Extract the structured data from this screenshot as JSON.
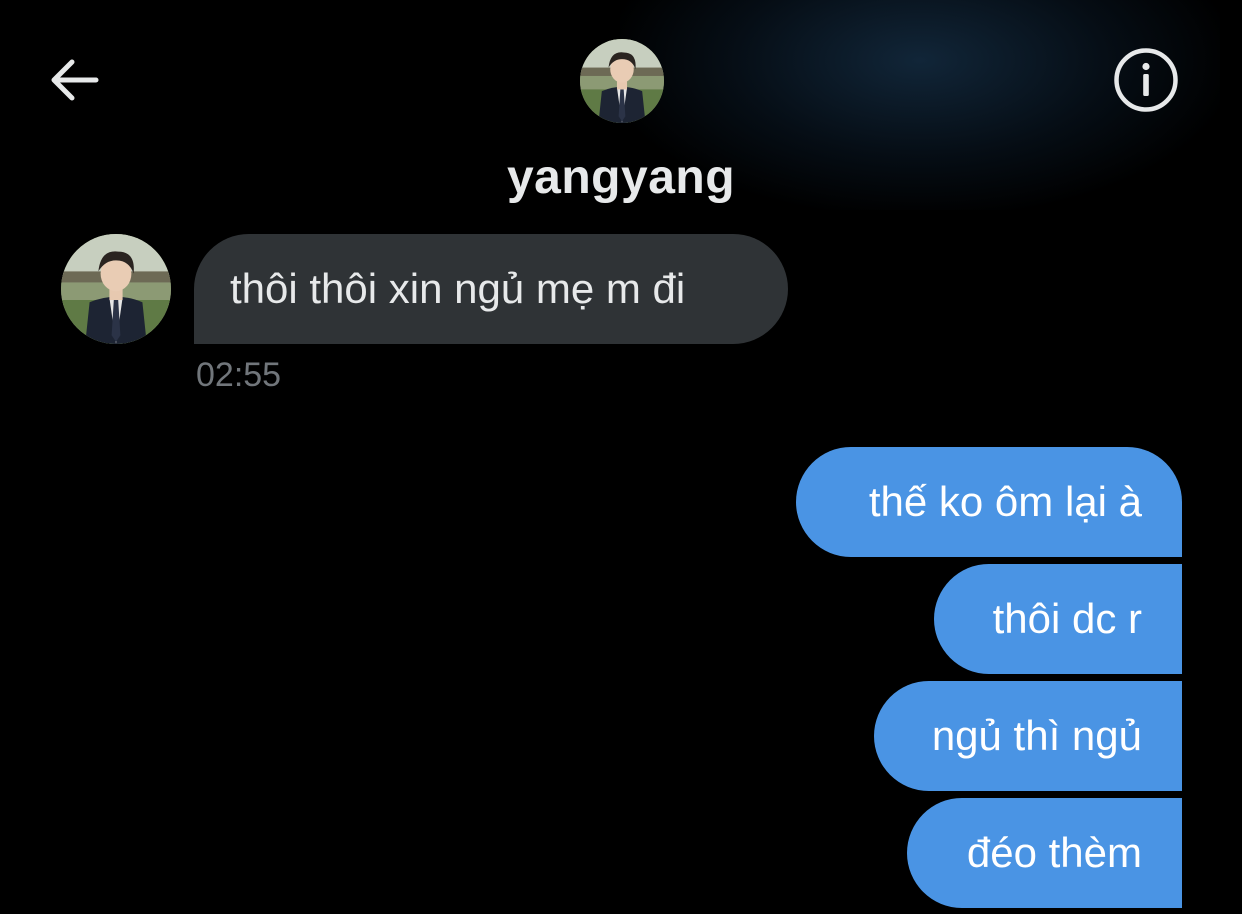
{
  "header": {
    "name": "yangyang",
    "back_icon": "arrow-left-icon",
    "info_icon": "info-circle-icon"
  },
  "conversation": {
    "incoming": [
      {
        "text": "thôi thôi xin ngủ mẹ m đi",
        "time": "02:55"
      }
    ],
    "outgoing": [
      {
        "text": "thế ko ôm lại à"
      },
      {
        "text": "thôi dc r"
      },
      {
        "text": "ngủ thì ngủ"
      },
      {
        "text": "đéo thèm"
      }
    ]
  },
  "colors": {
    "background": "#000000",
    "incoming_bubble": "#2f3336",
    "outgoing_bubble": "#4a94e4",
    "timestamp": "#71767b"
  }
}
